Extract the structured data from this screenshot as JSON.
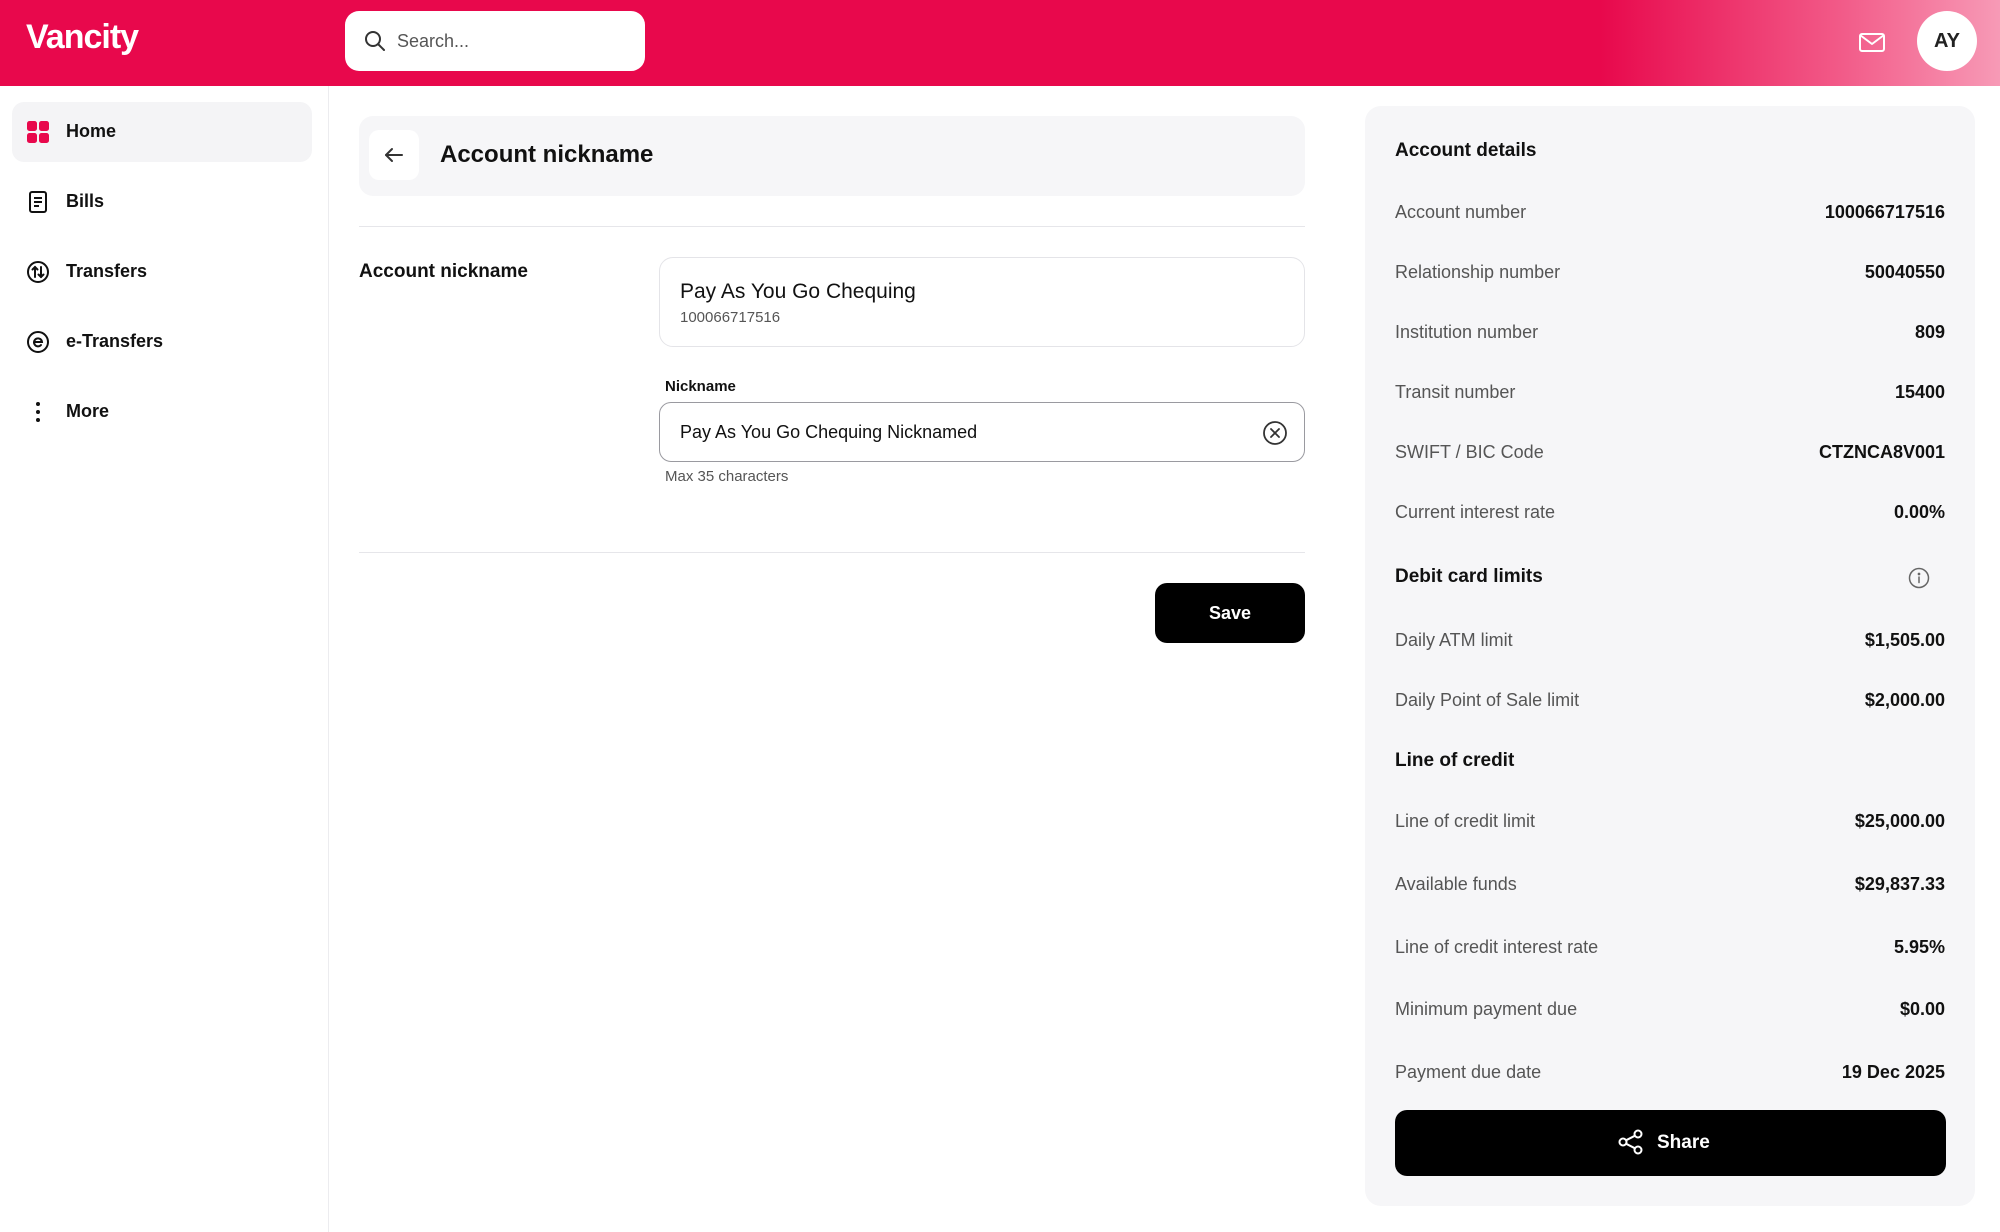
{
  "header": {
    "logo": "Vancity",
    "search_placeholder": "Search...",
    "avatar_initials": "AY"
  },
  "colors": {
    "brand": "#e8084c",
    "text": "#111111",
    "muted": "#555555",
    "panel_bg": "#f6f6f8"
  },
  "sidebar": {
    "items": [
      {
        "label": "Home",
        "icon": "home-grid-icon",
        "active": true
      },
      {
        "label": "Bills",
        "icon": "receipt-icon"
      },
      {
        "label": "Transfers",
        "icon": "transfer-icon"
      },
      {
        "label": "e-Transfers",
        "icon": "etransfer-icon"
      },
      {
        "label": "More",
        "icon": "more-vertical-icon"
      }
    ]
  },
  "main": {
    "title": "Account nickname",
    "section_label": "Account nickname",
    "account_card": {
      "name": "Pay As You Go Chequing",
      "number": "100066717516"
    },
    "nickname": {
      "label": "Nickname",
      "value": "Pay As You Go Chequing Nicknamed",
      "hint": "Max 35 characters"
    },
    "save_label": "Save"
  },
  "panel": {
    "account_details": {
      "heading": "Account details",
      "rows": [
        {
          "label": "Account number",
          "value": "100066717516"
        },
        {
          "label": "Relationship number",
          "value": "50040550"
        },
        {
          "label": "Institution number",
          "value": "809"
        },
        {
          "label": "Transit number",
          "value": "15400"
        },
        {
          "label": "SWIFT / BIC Code",
          "value": "CTZNCA8V001"
        },
        {
          "label": "Current interest rate",
          "value": "0.00%"
        }
      ]
    },
    "debit_limits": {
      "heading": "Debit card limits",
      "rows": [
        {
          "label": "Daily ATM limit",
          "value": "$1,505.00"
        },
        {
          "label": "Daily Point of Sale limit",
          "value": "$2,000.00"
        }
      ]
    },
    "line_of_credit": {
      "heading": "Line of credit",
      "rows": [
        {
          "label": "Line of credit limit",
          "value": "$25,000.00"
        },
        {
          "label": "Available funds",
          "value": "$29,837.33"
        },
        {
          "label": "Line of credit interest rate",
          "value": "5.95%"
        },
        {
          "label": "Minimum payment due",
          "value": "$0.00"
        },
        {
          "label": "Payment due date",
          "value": "19 Dec 2025"
        }
      ]
    },
    "share_label": "Share"
  }
}
